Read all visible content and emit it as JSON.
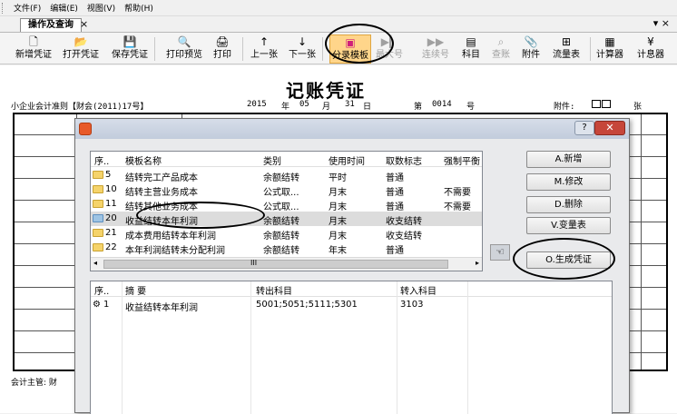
{
  "menu": [
    "文件(F)",
    "编辑(E)",
    "视图(V)",
    "帮助(H)"
  ],
  "tab": {
    "label": "操作及查询",
    "close": "×"
  },
  "window_close": "▾ ×",
  "toolbar": [
    {
      "icon": "new-icon",
      "glyph": "🗋",
      "label": "新增凭证",
      "enabled": true
    },
    {
      "icon": "open-icon",
      "glyph": "📂",
      "label": "打开凭证",
      "enabled": true
    },
    {
      "icon": "save-icon",
      "glyph": "💾",
      "label": "保存凭证",
      "enabled": true
    },
    {
      "icon": "preview-icon",
      "glyph": "🔍",
      "label": "打印预览",
      "enabled": true
    },
    {
      "icon": "print-icon",
      "glyph": "🖨",
      "label": "打印",
      "enabled": true
    },
    {
      "icon": "up-arrow-icon",
      "glyph": "↑",
      "label": "上一张",
      "enabled": true
    },
    {
      "icon": "down-arrow-icon",
      "glyph": "↓",
      "label": "下一张",
      "enabled": true
    },
    {
      "icon": "template-icon",
      "glyph": "▣",
      "label": "分录模板",
      "enabled": true
    },
    {
      "icon": "last-icon",
      "glyph": "▶▎",
      "label": "最大号",
      "enabled": false
    },
    {
      "icon": "renumber-icon",
      "glyph": "▶▶",
      "label": "连续号",
      "enabled": false
    },
    {
      "icon": "account-icon",
      "glyph": "▤",
      "label": "科目",
      "enabled": true
    },
    {
      "icon": "ledger-search-icon",
      "glyph": "⌕",
      "label": "查账",
      "enabled": false
    },
    {
      "icon": "attachment-icon",
      "glyph": "📎",
      "label": "附件",
      "enabled": true
    },
    {
      "icon": "flow-table-icon",
      "glyph": "⊞",
      "label": "流量表",
      "enabled": true
    },
    {
      "icon": "calculator-icon",
      "glyph": "▦",
      "label": "计算器",
      "enabled": true
    },
    {
      "icon": "interest-icon",
      "glyph": "¥",
      "label": "计息器",
      "enabled": true
    }
  ],
  "voucher": {
    "title": "记账凭证",
    "standard": "小企业会计准则【财会(2011)17号】",
    "year": "2015",
    "year_unit": "年",
    "month": "05",
    "month_unit": "月",
    "day": "31",
    "day_unit": "日",
    "number_label": "第",
    "number": "0014",
    "number_unit": "号",
    "attach_label": "附件:",
    "attach_unit": "张",
    "footer": "会计主管: 财"
  },
  "dialog": {
    "help": "?",
    "close": "✕",
    "template_headers": [
      "序..",
      "模板名称",
      "类别",
      "使用时间",
      "取数标志",
      "强制平衡"
    ],
    "templates": [
      {
        "no": "5",
        "name": "结转完工产品成本",
        "category": "余额结转",
        "time": "平时",
        "flag": "普通",
        "force": ""
      },
      {
        "no": "10",
        "name": "结转主营业务成本",
        "category": "公式取...",
        "time": "月末",
        "flag": "普通",
        "force": "不需要"
      },
      {
        "no": "11",
        "name": "结转其他业务成本",
        "category": "公式取...",
        "time": "月末",
        "flag": "普通",
        "force": "不需要"
      },
      {
        "no": "20",
        "name": "收益结转本年利润",
        "category": "余额结转",
        "time": "月末",
        "flag": "收支结转",
        "force": ""
      },
      {
        "no": "21",
        "name": "成本费用结转本年利润",
        "category": "余额结转",
        "time": "月末",
        "flag": "收支结转",
        "force": ""
      },
      {
        "no": "22",
        "name": "本年利润结转未分配利润",
        "category": "余额结转",
        "time": "年末",
        "flag": "普通",
        "force": ""
      }
    ],
    "scroll_mark": "III",
    "buttons": {
      "add": "A.新增",
      "edit": "M.修改",
      "delete": "D.删除",
      "variables": "V.变量表",
      "generate": "O.生成凭证"
    },
    "detail_headers": [
      "序..",
      "摘    要",
      "转出科目",
      "转入科目"
    ],
    "details": [
      {
        "no": "1",
        "summary": "收益结转本年利润",
        "out": "5001;5051;5111;5301",
        "in": "3103"
      }
    ]
  }
}
